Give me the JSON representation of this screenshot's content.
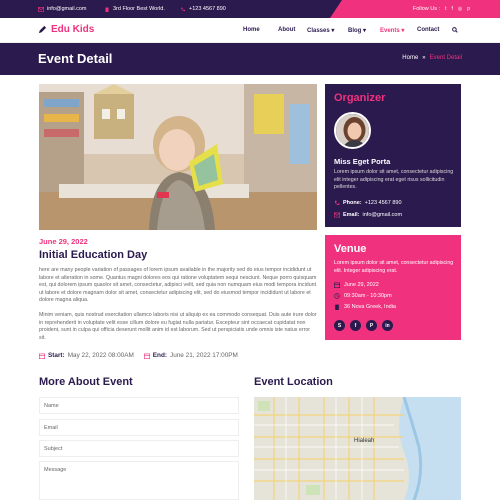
{
  "topbar": {
    "email": "info@gmail.com",
    "address": "3rd Floor Best World.",
    "phone": "+123 4567 890",
    "follow_label": "Follow Us :",
    "social_icons": [
      "twitter-icon",
      "facebook-icon",
      "instagram-icon",
      "pinterest-icon"
    ]
  },
  "nav": {
    "logo": "Edu Kids",
    "items": [
      {
        "label": "Home",
        "caret": ""
      },
      {
        "label": "About",
        "caret": ""
      },
      {
        "label": "Classes",
        "caret": "▾"
      },
      {
        "label": "Blog",
        "caret": "▾"
      },
      {
        "label": "Events",
        "caret": "▾"
      },
      {
        "label": "Contact",
        "caret": ""
      }
    ],
    "active": "Events"
  },
  "banner": {
    "title": "Event Detail",
    "breadcrumb_home": "Home",
    "breadcrumb_sep": "»",
    "breadcrumb_current": "Event Detail"
  },
  "event": {
    "date": "June 29, 2022",
    "title": "Initial Education Day",
    "para1": "here are many people variation of passages of lorem ipsum available in the majority sed do eius tempor incididunt ut labore et alteration in some. Quantus magni dolores eos qui ratione voluptatem sequi nesciunt. Neque porro quisquam est, qui dolorem ipsum quaolor sit amet, consectetur, adipisci velit, sed quia non numquam eius modi tempora incidunt ut labore et dolore magnam dolor sit amet, consectetur adipiscing elit, sed do eiusmod tempor incididunt ut labore et dolore magna aliqua.",
    "para2": "Minim veniam, quis nostrud exercitation ullamco laboris nisi ut aliquip ex ea commodo consequat. Duis aute irure dolor in reprehenderit in voluptate velit esse cillum dolore eu fugiat nulla pariatur. Excepteur sint occaecat cupidatat non proident, sunt in culpa qui officia deserunt mollit anim id est laborum. Sed ut perspiciatis unde omnis iste natus error sit.",
    "start_label": "Start:",
    "start_value": "May 22, 2022 08:00AM",
    "end_label": "End:",
    "end_value": "June 21, 2022 17:00PM"
  },
  "organizer": {
    "heading": "Organizer",
    "name": "Miss Eget Porta",
    "description": "Lorem ipsum dolor sit amet, consectetur adipiscing elit integer adipiscing erat eget risus sollicitudin pellentes.",
    "phone_label": "Phone:",
    "phone": "+123 4567 890",
    "email_label": "Email:",
    "email": "info@gmail.com"
  },
  "venue": {
    "heading": "Venue",
    "description": "Lorem ipsum dolor sit amet, consectetur adipiscing elit. Integer adipiscing erat.",
    "date": "June 29, 2022",
    "time": "09:30am - 10:30pm",
    "address": "36 Nova Greek, India",
    "social_icons": [
      "skype-icon",
      "facebook-icon",
      "pinterest-icon",
      "linkedin-icon"
    ],
    "social_glyphs": [
      "S",
      "f",
      "P",
      "in"
    ]
  },
  "form": {
    "heading": "More About Event",
    "name_placeholder": "Name",
    "email_placeholder": "Email",
    "subject_placeholder": "Subject",
    "message_placeholder": "Message"
  },
  "location": {
    "heading": "Event Location",
    "map_label": "Hialeah"
  },
  "colors": {
    "primary": "#2b1a4e",
    "accent": "#f0327e"
  }
}
